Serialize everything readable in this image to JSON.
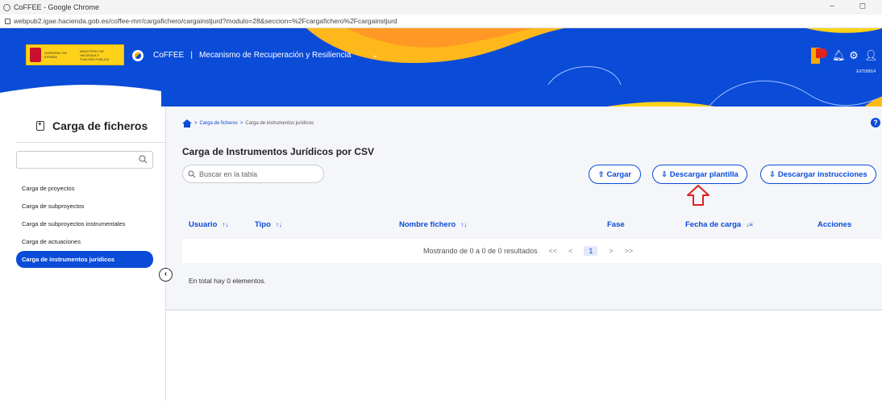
{
  "browser": {
    "window_title": "CoFFEE - Google Chrome",
    "url": "webpub2.igae.hacienda.gob.es/coffee-mrr/cargafichero/cargainstjurd?modulo=28&seccion=%2Fcargafichero%2Fcargainstjurd",
    "window_controls": "– ◻"
  },
  "header": {
    "gov_logo_text": "GOBIERNO DE ESPAÑA",
    "ministry_text": "MINISTERIO DE HACIENDA Y FUNCIÓN PÚBLICA",
    "app_name": "CoFFEE",
    "separator": "|",
    "module": "Mecanismo de Recuperación y Resiliencia",
    "user_code": "EXT00014",
    "accent": "#0a4bd8"
  },
  "sidebar": {
    "title": "Carga de ficheros",
    "items": [
      {
        "label": "Carga de proyectos"
      },
      {
        "label": "Carga de subproyectos"
      },
      {
        "label": "Carga de subproyectos instrumentales"
      },
      {
        "label": "Carga de actuaciones"
      },
      {
        "label": "Carga de instrumentos jurídicos",
        "active": true
      }
    ]
  },
  "breadcrumb": {
    "sep": ">",
    "level1": "Carga de ficheros",
    "current": "Carga de instrumentos jurídicos"
  },
  "main": {
    "title": "Carga de Instrumentos Jurídicos por CSV",
    "search_placeholder": "Buscar en la tabla",
    "buttons": {
      "upload": "Cargar",
      "download_template": "Descargar plantilla",
      "download_instructions": "Descargar instrucciones"
    },
    "table": {
      "columns": [
        "Usuario",
        "Tipo",
        "Nombre fichero",
        "Fase",
        "Fecha de carga",
        "Acciones"
      ],
      "pager": {
        "summary": "Mostrando de 0 a 0 de 0 resultados",
        "first": "<<",
        "prev": "<",
        "page": "1",
        "next": ">",
        "last": ">>"
      },
      "total": "En total hay 0 elementos."
    }
  }
}
